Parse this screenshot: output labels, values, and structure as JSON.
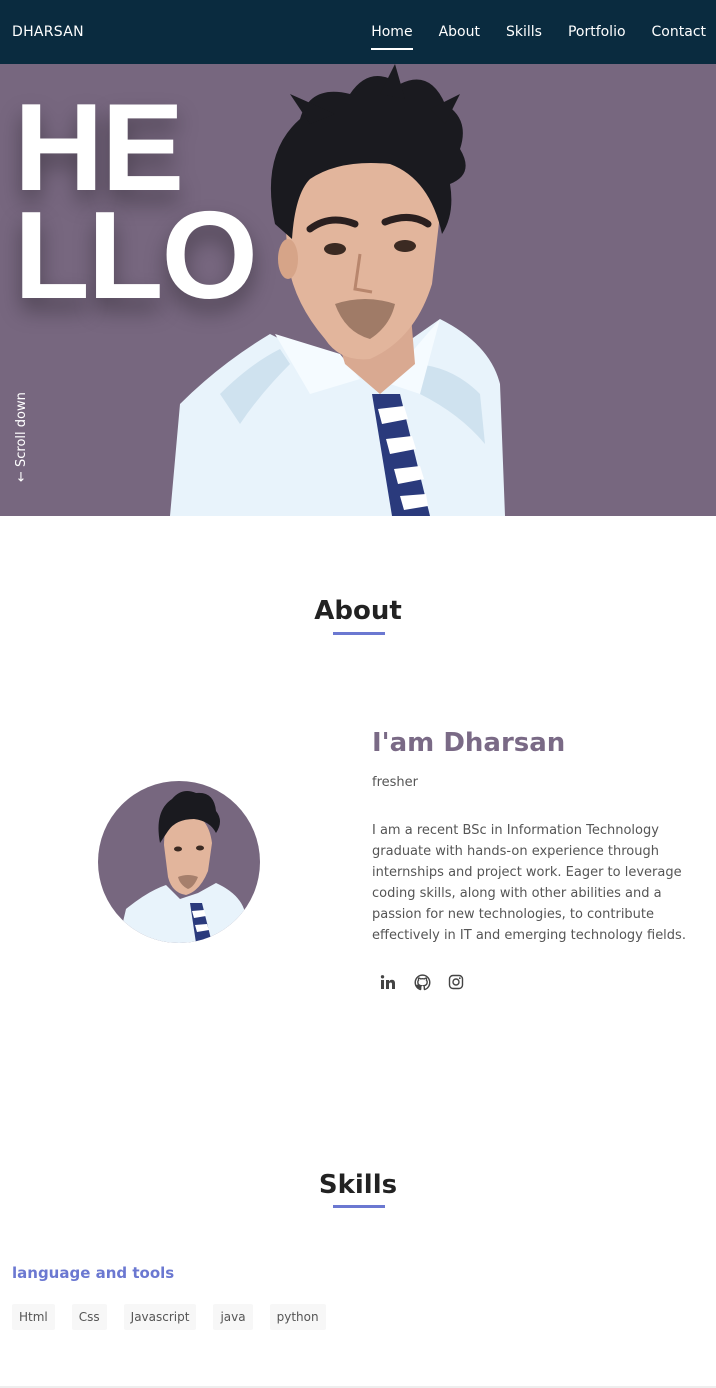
{
  "navbar": {
    "brand": "DHARSAN",
    "links": [
      {
        "label": "Home",
        "active": true
      },
      {
        "label": "About",
        "active": false
      },
      {
        "label": "Skills",
        "active": false
      },
      {
        "label": "Portfolio",
        "active": false
      },
      {
        "label": "Contact",
        "active": false
      }
    ]
  },
  "hero": {
    "hello_line1": "HE",
    "hello_line2": "LLO",
    "scroll_label": "← Scroll down"
  },
  "about": {
    "title": "About",
    "name": "I'am Dharsan",
    "role": "fresher",
    "description": "I am a recent BSc in Information Technology graduate with hands-on experience through internships and project work. Eager to leverage coding skills, along with other abilities and a passion for new technologies, to contribute effectively in IT and emerging technology fields.",
    "socials": [
      "linkedin-icon",
      "github-icon",
      "instagram-icon"
    ]
  },
  "skills": {
    "title": "Skills",
    "heading": "language and tools",
    "tags": [
      "Html",
      "Css",
      "Javascript",
      "java",
      "python"
    ]
  },
  "colors": {
    "navbar_bg": "#0a2b3f",
    "hero_bg": "#77677f",
    "accent": "#6b78d1",
    "name_color": "#7a6a86"
  }
}
